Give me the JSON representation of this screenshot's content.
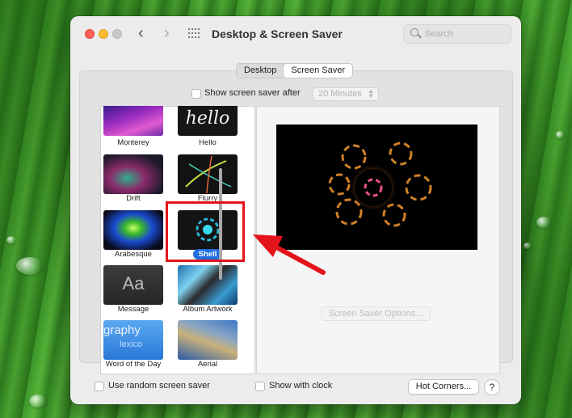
{
  "window": {
    "title": "Desktop & Screen Saver",
    "search_placeholder": "Search"
  },
  "tabs": [
    {
      "label": "Desktop",
      "active": false
    },
    {
      "label": "Screen Saver",
      "active": true
    }
  ],
  "idle": {
    "checkbox_label": "Show screen saver after",
    "selected": "20 Minutes"
  },
  "savers": [
    {
      "name": "Monterey",
      "selected": false
    },
    {
      "name": "Hello",
      "selected": false
    },
    {
      "name": "Drift",
      "selected": false
    },
    {
      "name": "Flurry",
      "selected": false
    },
    {
      "name": "Arabesque",
      "selected": false
    },
    {
      "name": "Shell",
      "selected": true
    },
    {
      "name": "Message",
      "selected": false
    },
    {
      "name": "Album Artwork",
      "selected": false
    },
    {
      "name": "Word of the Day",
      "selected": false
    },
    {
      "name": "Aerial",
      "selected": false
    }
  ],
  "thumb_text": {
    "hello": "hello",
    "message": "Aa",
    "word_of_day_big": "graphy",
    "word_of_day_small": "lexico"
  },
  "preview": {
    "options_button": "Screen Saver Options..."
  },
  "bottom": {
    "random_label": "Use random screen saver",
    "clock_label": "Show with clock",
    "hot_corners": "Hot Corners...",
    "help": "?"
  },
  "colors": {
    "accent": "#1f6de0",
    "annotation_red": "#e4131b"
  }
}
